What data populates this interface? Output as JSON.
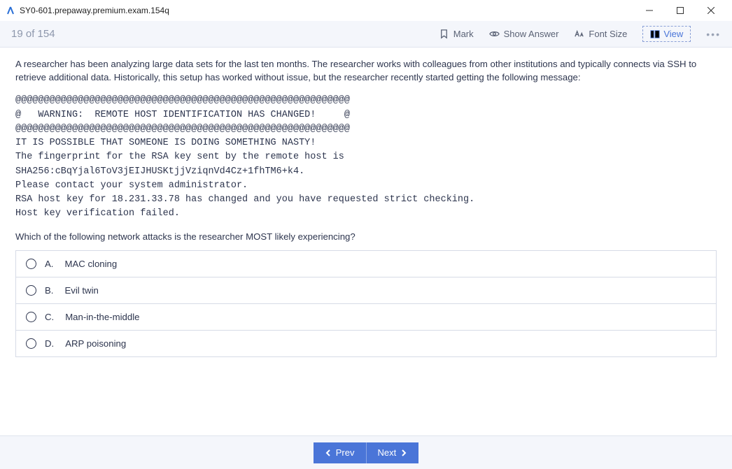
{
  "window": {
    "title": "SY0-601.prepaway.premium.exam.154q"
  },
  "toolbar": {
    "progress": "19 of 154",
    "mark_label": "Mark",
    "show_answer_label": "Show Answer",
    "font_size_label": "Font Size",
    "view_label": "View"
  },
  "question": {
    "intro": "A researcher has been analyzing large data sets for the last ten months. The researcher works with colleagues from other institutions and typically connects via SSH to retrieve additional data. Historically, this setup has worked without issue, but the researcher recently started getting the following message:",
    "code_lines": [
      "@@@@@@@@@@@@@@@@@@@@@@@@@@@@@@@@@@@@@@@@@@@@@@@@@@@@@@@@@@@",
      "@   WARNING:  REMOTE HOST IDENTIFICATION HAS CHANGED!     @",
      "@@@@@@@@@@@@@@@@@@@@@@@@@@@@@@@@@@@@@@@@@@@@@@@@@@@@@@@@@@@",
      "IT IS POSSIBLE THAT SOMEONE IS DOING SOMETHING NASTY!",
      "The fingerprint for the RSA key sent by the remote host is",
      "SHA256:cBqYjal6ToV3jEIJHUSKtjjVziqnVd4Cz+1fhTM6+k4.",
      "Please contact your system administrator.",
      "RSA host key for 18.231.33.78 has changed and you have requested strict checking.",
      "Host key verification failed."
    ],
    "follow": "Which of the following network attacks is the researcher MOST likely experiencing?",
    "options": [
      {
        "letter": "A.",
        "text": "MAC cloning"
      },
      {
        "letter": "B.",
        "text": "Evil twin"
      },
      {
        "letter": "C.",
        "text": "Man-in-the-middle"
      },
      {
        "letter": "D.",
        "text": "ARP poisoning"
      }
    ]
  },
  "footer": {
    "prev_label": "Prev",
    "next_label": "Next"
  }
}
